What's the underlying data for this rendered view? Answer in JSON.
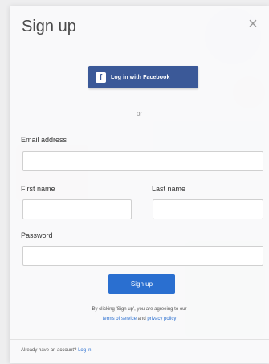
{
  "modal": {
    "title": "Sign up",
    "close_symbol": "×",
    "facebook_button": {
      "icon_glyph": "f",
      "label": "Log in with Facebook"
    },
    "divider_text": "or",
    "fields": {
      "email": {
        "label": "Email address",
        "value": ""
      },
      "first_name": {
        "label": "First name",
        "value": ""
      },
      "last_name": {
        "label": "Last name",
        "value": ""
      },
      "password": {
        "label": "Password",
        "value": ""
      }
    },
    "submit_label": "Sign up",
    "terms": {
      "line1": "By clicking 'Sign up', you are agreeing to our",
      "terms_link": "terms of service",
      "and": "and",
      "privacy_link": "privacy policy"
    },
    "footer": {
      "prompt": "Already have an account?",
      "login_link": "Log in"
    }
  },
  "colors": {
    "facebook_blue": "#3b5998",
    "primary_blue": "#2a6fd0"
  }
}
